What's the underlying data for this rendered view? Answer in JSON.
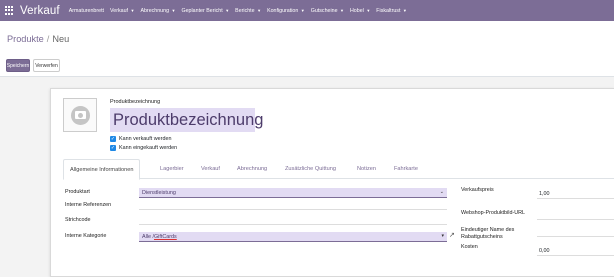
{
  "app": {
    "brand": "Verkauf",
    "menu": [
      {
        "label": "Armaturenbrett",
        "dropdown": false
      },
      {
        "label": "Verkauf",
        "dropdown": true
      },
      {
        "label": "Abrechnung",
        "dropdown": true
      },
      {
        "label": "Geplanter Bericht",
        "dropdown": true
      },
      {
        "label": "Berichte",
        "dropdown": true
      },
      {
        "label": "Konfiguration",
        "dropdown": true
      },
      {
        "label": "Gutscheine",
        "dropdown": true
      },
      {
        "label": "Hobel",
        "dropdown": true
      },
      {
        "label": "Fiskaltrust",
        "dropdown": true
      }
    ],
    "accent_color": "#7c6d96"
  },
  "breadcrumb": {
    "parent": "Produkte",
    "separator": "/",
    "current": "Neu"
  },
  "buttons": {
    "save": "Speichern",
    "discard": "Verwerfen"
  },
  "form": {
    "image_icon": "camera-icon",
    "name_label": "Produktbezeichnung",
    "name_value": "Produktbezeichnung",
    "can_be_sold": {
      "label": "Kann verkauft werden",
      "checked": true
    },
    "can_be_purchased": {
      "label": "Kann eingekauft werden",
      "checked": true
    },
    "tabs": [
      {
        "label": "Allgemeine Informationen",
        "active": true
      },
      {
        "label": "Lagerbier",
        "active": false
      },
      {
        "label": "Verkauf",
        "active": false
      },
      {
        "label": "Abrechnung",
        "active": false
      },
      {
        "label": "Zusätzliche Quittung",
        "active": false
      },
      {
        "label": "Notizen",
        "active": false
      },
      {
        "label": "Fahrkarte",
        "active": false
      }
    ],
    "left_fields": {
      "product_type": {
        "label": "Produktart",
        "value": "Dienstleistung"
      },
      "internal_reference": {
        "label": "Interne Referenzen",
        "value": ""
      },
      "barcode": {
        "label": "Strichcode",
        "value": ""
      },
      "internal_category": {
        "label": "Interne Kategorie",
        "value_prefix": "Alle / ",
        "value_highlight": "GiftCards"
      }
    },
    "right_fields": {
      "sales_price": {
        "label": "Verkaufspreis",
        "value": "1,00"
      },
      "webshop_url": {
        "label": "Webshop-Produktbild-URL",
        "value": ""
      },
      "voucher_name": {
        "label": "Eindeutiger Name des Rabattgutscheins",
        "value": ""
      },
      "cost": {
        "label": "Kosten",
        "value": "0,00"
      }
    }
  }
}
